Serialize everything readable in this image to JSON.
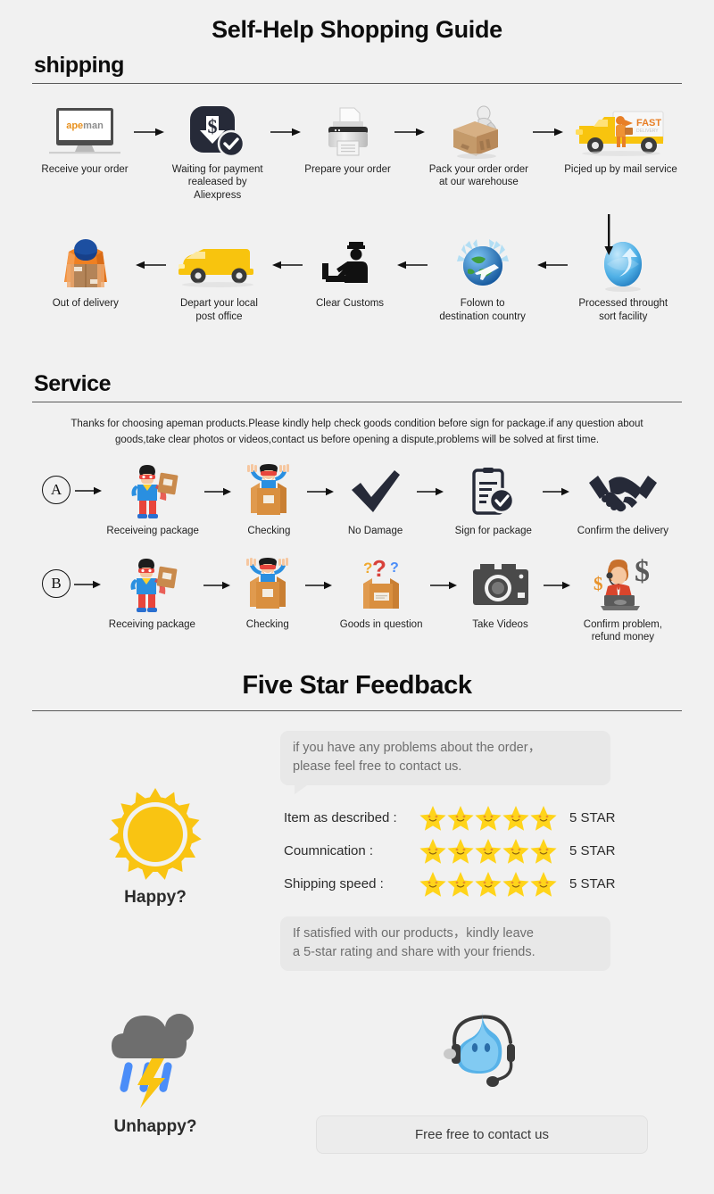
{
  "title": "Self-Help Shopping Guide",
  "sections": {
    "shipping": {
      "heading": "shipping",
      "row1": [
        {
          "icon": "monitor-apeman-icon",
          "label": "Receive your order"
        },
        {
          "icon": "payment-dollar-check-icon",
          "label": "Waiting for payment\nrealeased by Aliexpress"
        },
        {
          "icon": "printer-icon",
          "label": "Prepare your order"
        },
        {
          "icon": "packing-box-worker-icon",
          "label": "Pack your order order\nat our warehouse"
        },
        {
          "icon": "delivery-truck-fast-icon",
          "label": "Picjed up by mail service"
        }
      ],
      "row2": [
        {
          "icon": "courier-carrying-box-icon",
          "label": "Out of delivery"
        },
        {
          "icon": "yellow-van-icon",
          "label": "Depart your local\npost office"
        },
        {
          "icon": "customs-officer-icon",
          "label": "Clear Customs"
        },
        {
          "icon": "globe-airplane-icon",
          "label": "Folown to\ndestination country"
        },
        {
          "icon": "sort-facility-globe-icon",
          "label": "Processed throught\nsort facility"
        }
      ]
    },
    "service": {
      "heading": "Service",
      "paragraph": "Thanks for choosing apeman products.Please kindly help check goods condition before sign for package.if any question about goods,take clear photos or videos,contact us before opening a dispute,problems will be solved at first time.",
      "rowA": {
        "marker": "A",
        "steps": [
          {
            "icon": "superhero-package-icon",
            "label": "Receiveing package"
          },
          {
            "icon": "superhero-in-box-icon",
            "label": "Checking"
          },
          {
            "icon": "checkmark-icon",
            "label": "No Damage"
          },
          {
            "icon": "clipboard-check-icon",
            "label": "Sign for package"
          },
          {
            "icon": "handshake-icon",
            "label": "Confirm the delivery"
          }
        ]
      },
      "rowB": {
        "marker": "B",
        "steps": [
          {
            "icon": "superhero-package-icon",
            "label": "Receiving package"
          },
          {
            "icon": "superhero-in-box-icon",
            "label": "Checking"
          },
          {
            "icon": "question-box-icon",
            "label": "Goods in question"
          },
          {
            "icon": "camera-icon",
            "label": "Take Videos"
          },
          {
            "icon": "support-agent-refund-icon",
            "label": "Confirm problem,\nrefund money"
          }
        ]
      }
    },
    "feedback": {
      "heading": "Five Star Feedback",
      "bubble_top": "if you have any problems about the order，\nplease feel free to contact us.",
      "ratings": [
        {
          "label": "Item as described :",
          "stars": 5,
          "value": "5 STAR"
        },
        {
          "label": "Coumnication :",
          "stars": 5,
          "value": "5 STAR"
        },
        {
          "label": "Shipping speed :",
          "stars": 5,
          "value": "5 STAR"
        }
      ],
      "bubble_bottom": "If satisfied with our products，kindly leave\na 5-star rating and share with your friends.",
      "happy_label": "Happy?",
      "unhappy_label": "Unhappy?",
      "contact_label": "Free free to contact us"
    }
  },
  "colors": {
    "background": "#f1f1f1",
    "star": "#ffd41a",
    "sun": "#f9c412",
    "cloud": "#6e6e6e",
    "rain": "#4b8df8",
    "bolt": "#f9c412",
    "dark": "#262a38",
    "truck": "#f8c40e",
    "box": "#c08a52",
    "accent_orange": "#e87f26"
  }
}
